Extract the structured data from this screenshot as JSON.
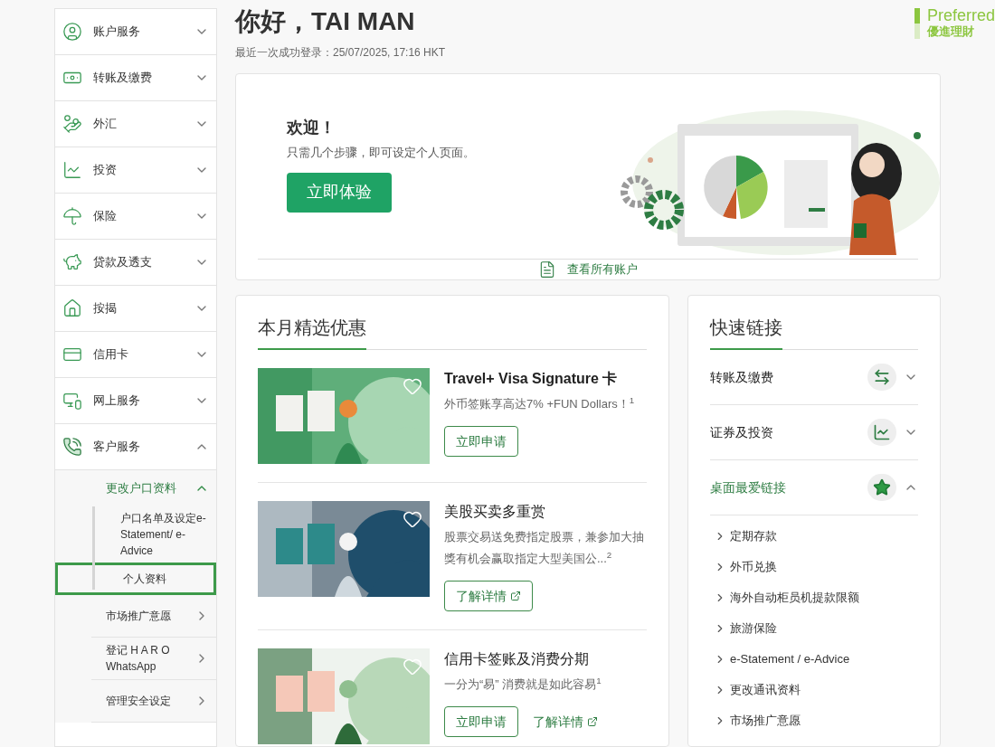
{
  "sidebar": {
    "items": [
      {
        "label": "账户服务",
        "expanded": false
      },
      {
        "label": "转账及缴费",
        "expanded": false
      },
      {
        "label": "外汇",
        "expanded": false
      },
      {
        "label": "投资",
        "expanded": false
      },
      {
        "label": "保险",
        "expanded": false
      },
      {
        "label": "贷款及透支",
        "expanded": false
      },
      {
        "label": "按揭",
        "expanded": false
      },
      {
        "label": "信用卡",
        "expanded": false
      },
      {
        "label": "网上服务",
        "expanded": false
      },
      {
        "label": "客户服务",
        "expanded": true,
        "children": [
          {
            "label": "更改户口资料",
            "kind": "group",
            "expanded": true,
            "children": [
              {
                "label": "户口名单及设定e-Statement/ e-Advice",
                "selected": false
              },
              {
                "label": "个人资料",
                "selected": true
              }
            ]
          },
          {
            "label": "市场推广意愿",
            "kind": "link"
          },
          {
            "label": "登记 H A R O WhatsApp",
            "kind": "link"
          },
          {
            "label": "管理安全设定",
            "kind": "link"
          }
        ]
      }
    ]
  },
  "header": {
    "greeting": "你好，TAI MAN",
    "last_login": "最近一次成功登录：25/07/2025, 17:16 HKT",
    "badge": {
      "title": "Preferred",
      "subtitle": "優進理財"
    }
  },
  "welcome": {
    "title": "欢迎！",
    "text": "只需几个步骤，即可设定个人页面。",
    "button": "立即体验",
    "footer_link": "查看所有账户"
  },
  "offers": {
    "title": "本月精选优惠",
    "items": [
      {
        "title": "Travel+ Visa Signature 卡",
        "description": "外币签账享高达7% +FUN Dollars！$^{1}$",
        "buttons": [
          {
            "label": "立即申请",
            "kind": "outline",
            "external": false
          }
        ]
      },
      {
        "title": "美股买卖多重赏",
        "description": "股票交易送免费指定股票，兼参加大抽獎有机会赢取指定大型美国公...$^{2}$",
        "buttons": [
          {
            "label": "了解详情",
            "kind": "outline",
            "external": true
          }
        ]
      },
      {
        "title": "信用卡签账及消费分期",
        "description": "一分为“易” 消费就是如此容易$^{1}$",
        "buttons": [
          {
            "label": "立即申请",
            "kind": "outline",
            "external": false
          },
          {
            "label": "了解详情",
            "kind": "link",
            "external": true
          }
        ]
      }
    ]
  },
  "quick_links": {
    "title": "快速链接",
    "sections": [
      {
        "label": "转账及缴费",
        "expanded": false
      },
      {
        "label": "证券及投资",
        "expanded": false
      },
      {
        "label": "桌面最爱链接",
        "expanded": true,
        "links": [
          "定期存款",
          "外币兑换",
          "海外自动柜员机提款限额",
          "旅游保险",
          "e-Statement / e-Advice",
          "更改通讯资料",
          "市场推广意愿"
        ]
      }
    ]
  }
}
